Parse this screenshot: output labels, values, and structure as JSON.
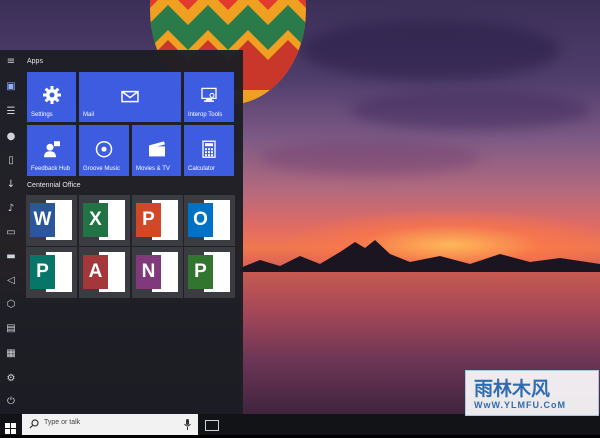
{
  "start_menu": {
    "apps_group_title": "Apps",
    "office_group_title": "Centennial Office",
    "tiles": [
      {
        "label": "Settings",
        "icon": "gear-icon"
      },
      {
        "label": "Mail",
        "icon": "mail-icon"
      },
      {
        "label": "Interop Tools",
        "icon": "interop-tools-icon"
      },
      {
        "label": "Feedback Hub",
        "icon": "feedback-hub-icon"
      },
      {
        "label": "Groove Music",
        "icon": "groove-music-icon"
      },
      {
        "label": "Movies & TV",
        "icon": "movies-tv-icon"
      },
      {
        "label": "Calculator",
        "icon": "calculator-icon"
      }
    ],
    "office_tiles": [
      {
        "letter": "W",
        "name": "Word",
        "color": "#2b579a"
      },
      {
        "letter": "X",
        "name": "Excel",
        "color": "#217346"
      },
      {
        "letter": "P",
        "name": "PowerPoint",
        "color": "#d24726"
      },
      {
        "letter": "O",
        "name": "Outlook",
        "color": "#0072c6"
      },
      {
        "letter": "P",
        "name": "Publisher",
        "color": "#077568"
      },
      {
        "letter": "A",
        "name": "Access",
        "color": "#a4373a"
      },
      {
        "letter": "N",
        "name": "OneNote",
        "color": "#80397b"
      },
      {
        "letter": "P",
        "name": "Project",
        "color": "#31752f"
      }
    ]
  },
  "taskbar": {
    "search_placeholder": "Type or talk"
  },
  "watermark": {
    "title": "雨林木风",
    "url": "WwW.YLMFU.CoM"
  },
  "colors": {
    "tile_blue": "#3d5ce0",
    "start_bg": "#1c1e24",
    "taskbar_bg": "#121316"
  }
}
